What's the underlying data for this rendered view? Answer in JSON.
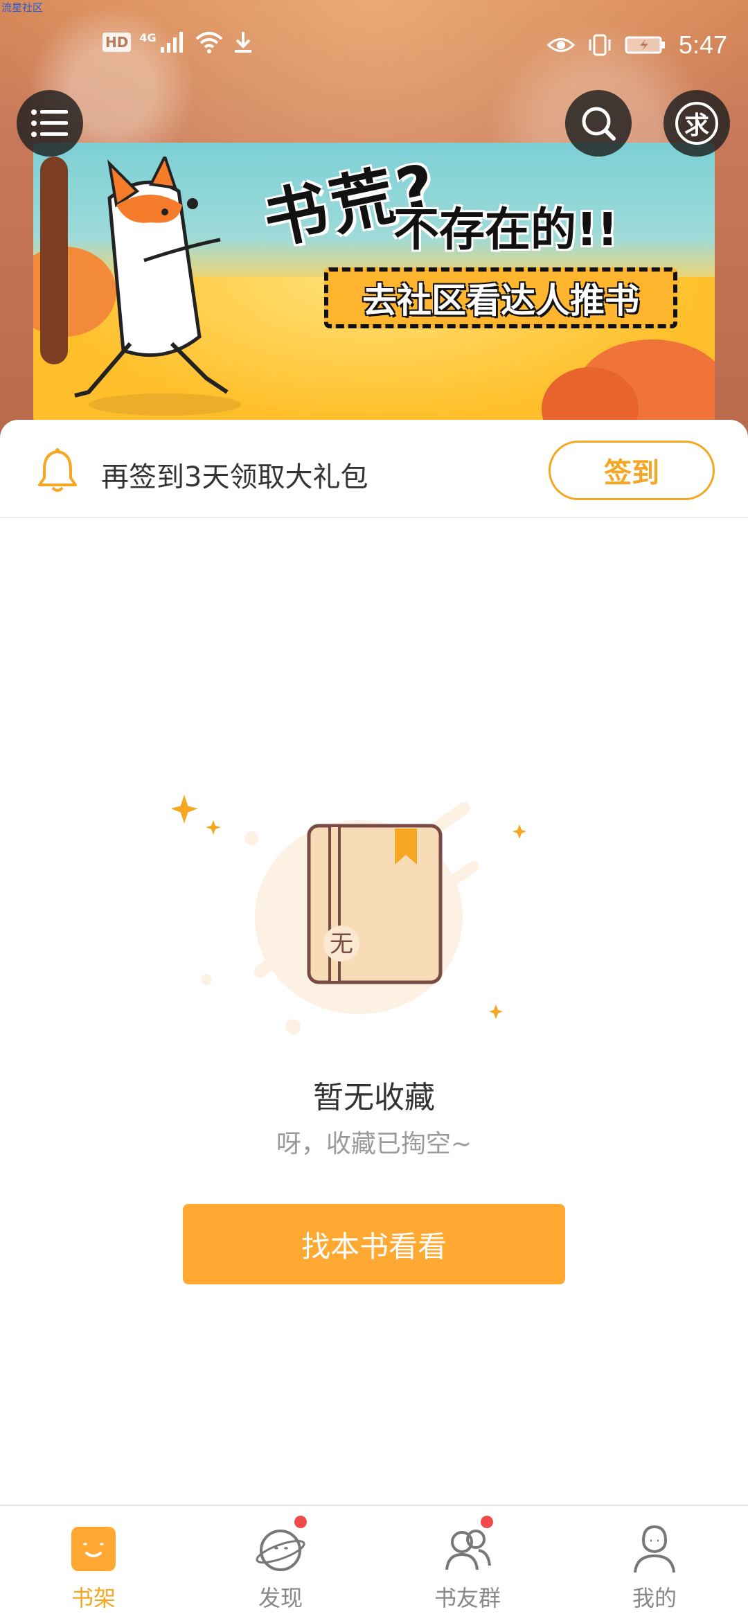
{
  "watermark": "流星社区",
  "status_bar": {
    "hd": "HD",
    "network": "4G",
    "time": "5:47"
  },
  "header": {
    "menu_icon": "menu-icon",
    "search_icon": "search-icon",
    "request_badge": "求"
  },
  "banner": {
    "title_line1": "书荒?",
    "title_line2": "不存在的!!",
    "cta": "去社区看达人推书"
  },
  "checkin": {
    "text": "再签到3天领取大礼包",
    "button": "签到"
  },
  "empty_state": {
    "book_badge": "无",
    "title": "暂无收藏",
    "subtitle": "呀，收藏已掏空~",
    "button": "找本书看看"
  },
  "bottom_nav": [
    {
      "label": "书架",
      "icon": "bookshelf-icon",
      "active": true,
      "dot": false
    },
    {
      "label": "发现",
      "icon": "discover-icon",
      "active": false,
      "dot": true
    },
    {
      "label": "书友群",
      "icon": "group-icon",
      "active": false,
      "dot": true
    },
    {
      "label": "我的",
      "icon": "profile-icon",
      "active": false,
      "dot": false
    }
  ],
  "colors": {
    "accent": "#f5a623",
    "button": "#ffa933",
    "dot": "#f04a4a"
  }
}
